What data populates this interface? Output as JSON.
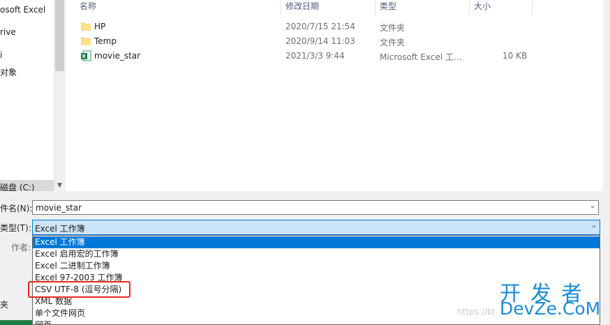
{
  "nav": {
    "items": [
      {
        "label": "osoft Excel"
      },
      {
        "label": "rive"
      },
      {
        "label": "i"
      },
      {
        "label": "对象"
      },
      {
        "label": "磁盘 (C:)"
      }
    ]
  },
  "file_list": {
    "headers": {
      "name": "名称",
      "date": "修改日期",
      "type": "类型",
      "size": "大小"
    },
    "rows": [
      {
        "name": "HP",
        "date": "2020/7/15 21:54",
        "type": "文件夹",
        "size": "",
        "icon": "folder-icon"
      },
      {
        "name": "Temp",
        "date": "2020/9/14 11:03",
        "type": "文件夹",
        "size": "",
        "icon": "folder-icon"
      },
      {
        "name": "movie_star",
        "date": "2021/3/3 9:44",
        "type": "Microsoft Excel 工...",
        "size": "10 KB",
        "icon": "excel-file-icon"
      }
    ]
  },
  "form": {
    "filename_label": "件名(N):",
    "filename_value": "movie_star",
    "type_label": "类型(T):",
    "type_value": "Excel 工作簿",
    "author_label": "作者:",
    "folder_label": "夹"
  },
  "dropdown": {
    "options": [
      {
        "label": "Excel 工作簿"
      },
      {
        "label": "Excel 启用宏的工作簿"
      },
      {
        "label": "Excel 二进制工作簿"
      },
      {
        "label": "Excel 97-2003 工作簿"
      },
      {
        "label": "CSV UTF-8 (逗号分隔)"
      },
      {
        "label": "XML 数据"
      },
      {
        "label": "单个文件网页"
      },
      {
        "label": "网页"
      }
    ],
    "selected_index": 0,
    "highlighted_index": 4
  },
  "watermark": {
    "cn": "开发者",
    "en": "DevZe.CoM",
    "url": "https://bl"
  },
  "colors": {
    "selection": "#0078d7",
    "type_box": "#cce4f7",
    "highlight_border": "#e8261d",
    "watermark": "#1a8cd8"
  }
}
